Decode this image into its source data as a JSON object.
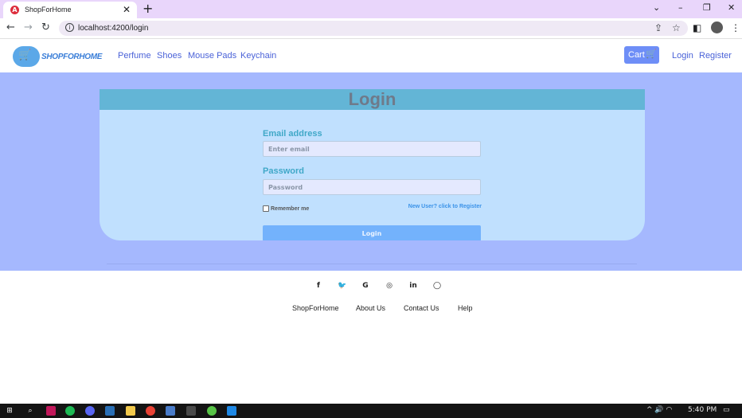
{
  "browser": {
    "tab_title": "ShopForHome",
    "tab_close": "✕",
    "new_tab": "+",
    "url": "localhost:4200/login",
    "window_controls": [
      "⌄",
      "–",
      "❐",
      "✕"
    ],
    "icons": {
      "back": "←",
      "forward": "→",
      "reload": "↻",
      "info": "i",
      "share": "⇪",
      "star": "☆",
      "sidebar": "◧",
      "menu": "⋮"
    }
  },
  "navbar": {
    "logo_text": "SHOPFORHOME",
    "logo_icon": "🛒",
    "links": [
      "Perfume",
      "Shoes",
      "Mouse Pads",
      "Keychain"
    ],
    "cart_label": "Cart",
    "cart_icon": "🛒",
    "login": "Login",
    "register": "Register"
  },
  "login_card": {
    "title": "Login",
    "email_label": "Email address",
    "email_placeholder": "Enter email",
    "password_label": "Password",
    "password_placeholder": "Password",
    "remember_label": "Remember me",
    "register_link": "New User? click to Register",
    "submit": "Login"
  },
  "footer": {
    "social_icons": [
      "f",
      "🐦",
      "G",
      "◎",
      "in",
      "◯"
    ],
    "links": [
      "ShopForHome",
      "About Us",
      "Contact Us",
      "Help"
    ]
  },
  "taskbar": {
    "time": "5:40 PM",
    "tray_icons": "^ 🔊 ◠"
  },
  "colors": {
    "tabbar": "#e9d6fb",
    "brand_blue": "#4a62d8",
    "main_bg": "#a5b8fe",
    "card_bg": "#c0e0fe",
    "card_header": "#63b5d6",
    "button": "#73b2fc"
  }
}
